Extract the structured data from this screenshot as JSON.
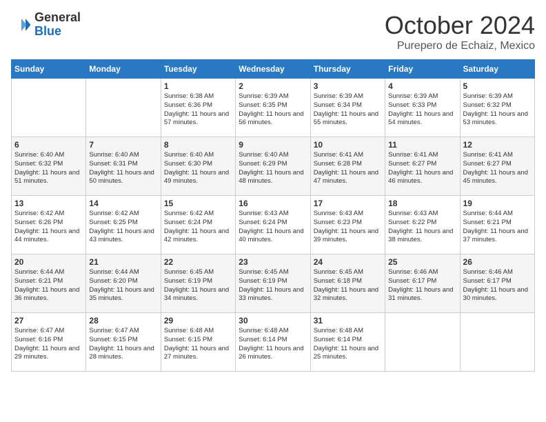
{
  "header": {
    "logo_general": "General",
    "logo_blue": "Blue",
    "month_title": "October 2024",
    "location": "Purepero de Echaiz, Mexico"
  },
  "days_of_week": [
    "Sunday",
    "Monday",
    "Tuesday",
    "Wednesday",
    "Thursday",
    "Friday",
    "Saturday"
  ],
  "weeks": [
    [
      {
        "day": "",
        "info": ""
      },
      {
        "day": "",
        "info": ""
      },
      {
        "day": "1",
        "info": "Sunrise: 6:38 AM\nSunset: 6:36 PM\nDaylight: 11 hours and 57 minutes."
      },
      {
        "day": "2",
        "info": "Sunrise: 6:39 AM\nSunset: 6:35 PM\nDaylight: 11 hours and 56 minutes."
      },
      {
        "day": "3",
        "info": "Sunrise: 6:39 AM\nSunset: 6:34 PM\nDaylight: 11 hours and 55 minutes."
      },
      {
        "day": "4",
        "info": "Sunrise: 6:39 AM\nSunset: 6:33 PM\nDaylight: 11 hours and 54 minutes."
      },
      {
        "day": "5",
        "info": "Sunrise: 6:39 AM\nSunset: 6:32 PM\nDaylight: 11 hours and 53 minutes."
      }
    ],
    [
      {
        "day": "6",
        "info": "Sunrise: 6:40 AM\nSunset: 6:32 PM\nDaylight: 11 hours and 51 minutes."
      },
      {
        "day": "7",
        "info": "Sunrise: 6:40 AM\nSunset: 6:31 PM\nDaylight: 11 hours and 50 minutes."
      },
      {
        "day": "8",
        "info": "Sunrise: 6:40 AM\nSunset: 6:30 PM\nDaylight: 11 hours and 49 minutes."
      },
      {
        "day": "9",
        "info": "Sunrise: 6:40 AM\nSunset: 6:29 PM\nDaylight: 11 hours and 48 minutes."
      },
      {
        "day": "10",
        "info": "Sunrise: 6:41 AM\nSunset: 6:28 PM\nDaylight: 11 hours and 47 minutes."
      },
      {
        "day": "11",
        "info": "Sunrise: 6:41 AM\nSunset: 6:27 PM\nDaylight: 11 hours and 46 minutes."
      },
      {
        "day": "12",
        "info": "Sunrise: 6:41 AM\nSunset: 6:27 PM\nDaylight: 11 hours and 45 minutes."
      }
    ],
    [
      {
        "day": "13",
        "info": "Sunrise: 6:42 AM\nSunset: 6:26 PM\nDaylight: 11 hours and 44 minutes."
      },
      {
        "day": "14",
        "info": "Sunrise: 6:42 AM\nSunset: 6:25 PM\nDaylight: 11 hours and 43 minutes."
      },
      {
        "day": "15",
        "info": "Sunrise: 6:42 AM\nSunset: 6:24 PM\nDaylight: 11 hours and 42 minutes."
      },
      {
        "day": "16",
        "info": "Sunrise: 6:43 AM\nSunset: 6:24 PM\nDaylight: 11 hours and 40 minutes."
      },
      {
        "day": "17",
        "info": "Sunrise: 6:43 AM\nSunset: 6:23 PM\nDaylight: 11 hours and 39 minutes."
      },
      {
        "day": "18",
        "info": "Sunrise: 6:43 AM\nSunset: 6:22 PM\nDaylight: 11 hours and 38 minutes."
      },
      {
        "day": "19",
        "info": "Sunrise: 6:44 AM\nSunset: 6:21 PM\nDaylight: 11 hours and 37 minutes."
      }
    ],
    [
      {
        "day": "20",
        "info": "Sunrise: 6:44 AM\nSunset: 6:21 PM\nDaylight: 11 hours and 36 minutes."
      },
      {
        "day": "21",
        "info": "Sunrise: 6:44 AM\nSunset: 6:20 PM\nDaylight: 11 hours and 35 minutes."
      },
      {
        "day": "22",
        "info": "Sunrise: 6:45 AM\nSunset: 6:19 PM\nDaylight: 11 hours and 34 minutes."
      },
      {
        "day": "23",
        "info": "Sunrise: 6:45 AM\nSunset: 6:19 PM\nDaylight: 11 hours and 33 minutes."
      },
      {
        "day": "24",
        "info": "Sunrise: 6:45 AM\nSunset: 6:18 PM\nDaylight: 11 hours and 32 minutes."
      },
      {
        "day": "25",
        "info": "Sunrise: 6:46 AM\nSunset: 6:17 PM\nDaylight: 11 hours and 31 minutes."
      },
      {
        "day": "26",
        "info": "Sunrise: 6:46 AM\nSunset: 6:17 PM\nDaylight: 11 hours and 30 minutes."
      }
    ],
    [
      {
        "day": "27",
        "info": "Sunrise: 6:47 AM\nSunset: 6:16 PM\nDaylight: 11 hours and 29 minutes."
      },
      {
        "day": "28",
        "info": "Sunrise: 6:47 AM\nSunset: 6:15 PM\nDaylight: 11 hours and 28 minutes."
      },
      {
        "day": "29",
        "info": "Sunrise: 6:48 AM\nSunset: 6:15 PM\nDaylight: 11 hours and 27 minutes."
      },
      {
        "day": "30",
        "info": "Sunrise: 6:48 AM\nSunset: 6:14 PM\nDaylight: 11 hours and 26 minutes."
      },
      {
        "day": "31",
        "info": "Sunrise: 6:48 AM\nSunset: 6:14 PM\nDaylight: 11 hours and 25 minutes."
      },
      {
        "day": "",
        "info": ""
      },
      {
        "day": "",
        "info": ""
      }
    ]
  ]
}
